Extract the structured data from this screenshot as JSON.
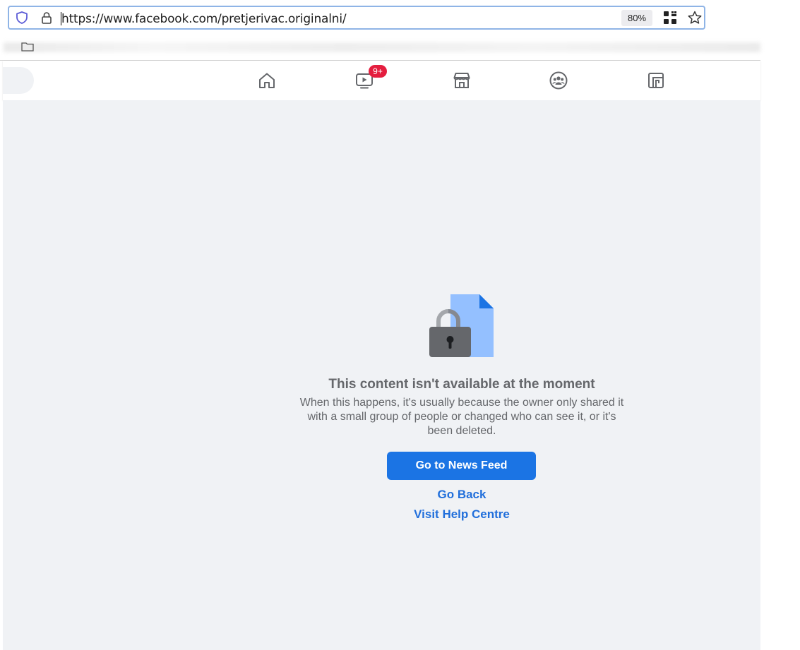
{
  "browser": {
    "url": "https://www.facebook.com/pretjerivac.originalni/",
    "zoom": "80%",
    "icons": [
      "shield-icon",
      "lock-icon",
      "qr-code-icon",
      "bookmark-star-icon"
    ]
  },
  "fb_nav": {
    "items": [
      {
        "name": "home",
        "icon": "home-icon"
      },
      {
        "name": "watch",
        "icon": "video-icon",
        "badge": "9+"
      },
      {
        "name": "marketplace",
        "icon": "store-icon"
      },
      {
        "name": "groups",
        "icon": "groups-icon"
      },
      {
        "name": "gaming",
        "icon": "gaming-icon"
      }
    ]
  },
  "message": {
    "title": "This content isn't available at the moment",
    "description": "When this happens, it's usually because the owner only shared it with a small group of people or changed who can see it, or it's been deleted.",
    "primary_button": "Go to News Feed",
    "go_back": "Go Back",
    "help": "Visit Help Centre"
  },
  "colors": {
    "primary": "#1b74e4",
    "link": "#216fdb",
    "background": "#f0f2f5",
    "badge": "#e41e3f",
    "muted_text": "#65676b"
  }
}
